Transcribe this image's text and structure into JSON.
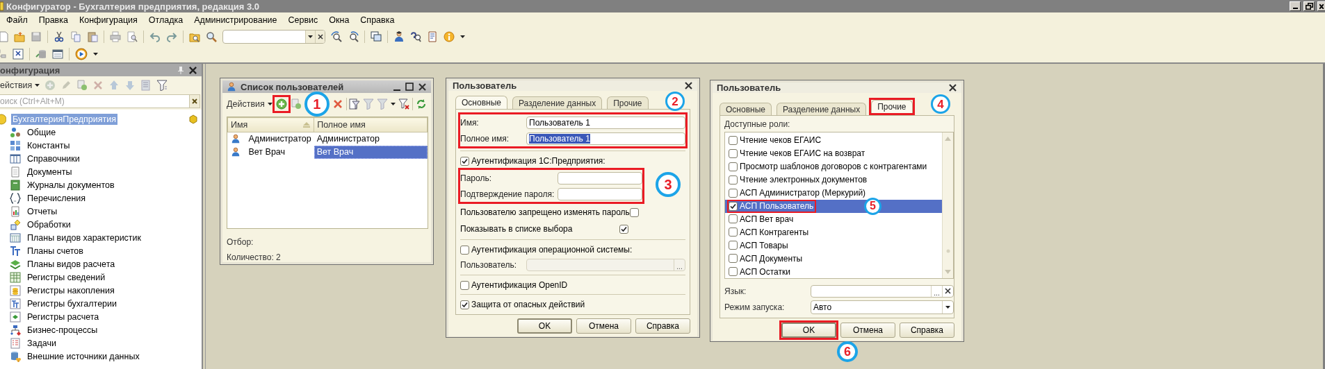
{
  "window": {
    "title": "Конфигуратор - Бухгалтерия предприятия, редакция 3.0"
  },
  "menu": [
    "Файл",
    "Правка",
    "Конфигурация",
    "Отладка",
    "Администрирование",
    "Сервис",
    "Окна",
    "Справка"
  ],
  "config_panel": {
    "title": "онфигурация",
    "actions": "ействия",
    "search": {
      "placeholder": "оиск (Ctrl+Alt+M)"
    },
    "tree": [
      {
        "label": "БухгалтерияПредприятия",
        "selected": true,
        "children": [
          {
            "label": "Общие",
            "selected": false
          },
          {
            "label": "Константы",
            "selected": false
          },
          {
            "label": "Справочники",
            "selected": false
          },
          {
            "label": "Документы",
            "selected": false
          },
          {
            "label": "Журналы документов",
            "selected": false
          },
          {
            "label": "Перечисления",
            "selected": false
          },
          {
            "label": "Отчеты",
            "selected": false
          },
          {
            "label": "Обработки",
            "selected": false
          },
          {
            "label": "Планы видов характеристик",
            "selected": false
          },
          {
            "label": "Планы счетов",
            "selected": false
          },
          {
            "label": "Планы видов расчета",
            "selected": false
          },
          {
            "label": "Регистры сведений",
            "selected": false
          },
          {
            "label": "Регистры накопления",
            "selected": false
          },
          {
            "label": "Регистры бухгалтерии",
            "selected": false
          },
          {
            "label": "Регистры расчета",
            "selected": false
          },
          {
            "label": "Бизнес-процессы",
            "selected": false
          },
          {
            "label": "Задачи",
            "selected": false
          },
          {
            "label": "Внешние источники данных",
            "selected": false
          }
        ]
      }
    ]
  },
  "users_list": {
    "title": "Список пользователей",
    "actions": "Действия",
    "columns": [
      "Имя",
      "Полное имя"
    ],
    "rows": [
      {
        "name": "Администратор",
        "full_name": "Администратор",
        "selected": false
      },
      {
        "name": "Вет Врач",
        "full_name": "Вет Врач",
        "selected": true
      }
    ],
    "filter_label": "Отбор:",
    "count": "Количество: 2"
  },
  "user_form": {
    "title": "Пользователь",
    "tabs": [
      {
        "label": "Основные",
        "selected": true
      },
      {
        "label": "Разделение данных",
        "selected": false
      },
      {
        "label": "Прочие",
        "selected": false
      }
    ],
    "name": {
      "label": "Имя:",
      "value": "Пользователь 1"
    },
    "full_name": {
      "label": "Полное имя:",
      "value": "Пользователь 1",
      "text_selected": true
    },
    "auth_1c": {
      "label": "Аутентификация 1С:Предприятия:",
      "checked": true
    },
    "password": {
      "label": "Пароль:"
    },
    "password_confirm": {
      "label": "Подтверждение пароля:"
    },
    "options": [
      {
        "label": "Пользователю запрещено изменять пароль",
        "checked": false
      },
      {
        "label": "Показывать в списке выбора",
        "checked": true
      }
    ],
    "os_auth": {
      "label": "Аутентификация операционной системы:",
      "checked": false
    },
    "os_user": {
      "label": "Пользователь:",
      "disabled": true,
      "button": "..."
    },
    "openid": {
      "label": "Аутентификация OpenID",
      "checked": false
    },
    "protection": {
      "label": "Защита от опасных действий",
      "checked": true
    },
    "buttons": [
      {
        "label": "OK",
        "default": true
      },
      {
        "label": "Отмена",
        "default": false
      },
      {
        "label": "Справка",
        "default": false
      }
    ]
  },
  "roles_form": {
    "title": "Пользователь",
    "tabs": [
      {
        "label": "Основные",
        "selected": false
      },
      {
        "label": "Разделение данных",
        "selected": false
      },
      {
        "label": "Прочие",
        "selected": true
      }
    ],
    "roles_label": "Доступные роли:",
    "roles": [
      {
        "label": "Чтение чеков ЕГАИС",
        "checked": false,
        "selected": false
      },
      {
        "label": "Чтение чеков ЕГАИС на возврат",
        "checked": false,
        "selected": false
      },
      {
        "label": "Просмотр шаблонов договоров с контрагентами",
        "checked": false,
        "selected": false
      },
      {
        "label": "Чтение электронных документов",
        "checked": false,
        "selected": false
      },
      {
        "label": "АСП Администратор (Меркурий)",
        "checked": false,
        "selected": false
      },
      {
        "label": "АСП Пользователь",
        "checked": true,
        "selected": true
      },
      {
        "label": "АСП Вет врач",
        "checked": false,
        "selected": false
      },
      {
        "label": "АСП Контрагенты",
        "checked": false,
        "selected": false
      },
      {
        "label": "АСП Товары",
        "checked": false,
        "selected": false
      },
      {
        "label": "АСП Документы",
        "checked": false,
        "selected": false
      },
      {
        "label": "АСП Остатки",
        "checked": false,
        "selected": false
      }
    ],
    "language": {
      "label": "Язык:",
      "button": "..."
    },
    "launch_mode": {
      "label": "Режим запуска:",
      "value": "Авто"
    },
    "buttons": [
      {
        "label": "OK",
        "default": true
      },
      {
        "label": "Отмена",
        "default": false
      },
      {
        "label": "Справка",
        "default": false
      }
    ]
  },
  "annotations": [
    {
      "number": "1"
    },
    {
      "number": "2"
    },
    {
      "number": "3"
    },
    {
      "number": "4"
    },
    {
      "number": "5"
    },
    {
      "number": "6"
    }
  ]
}
